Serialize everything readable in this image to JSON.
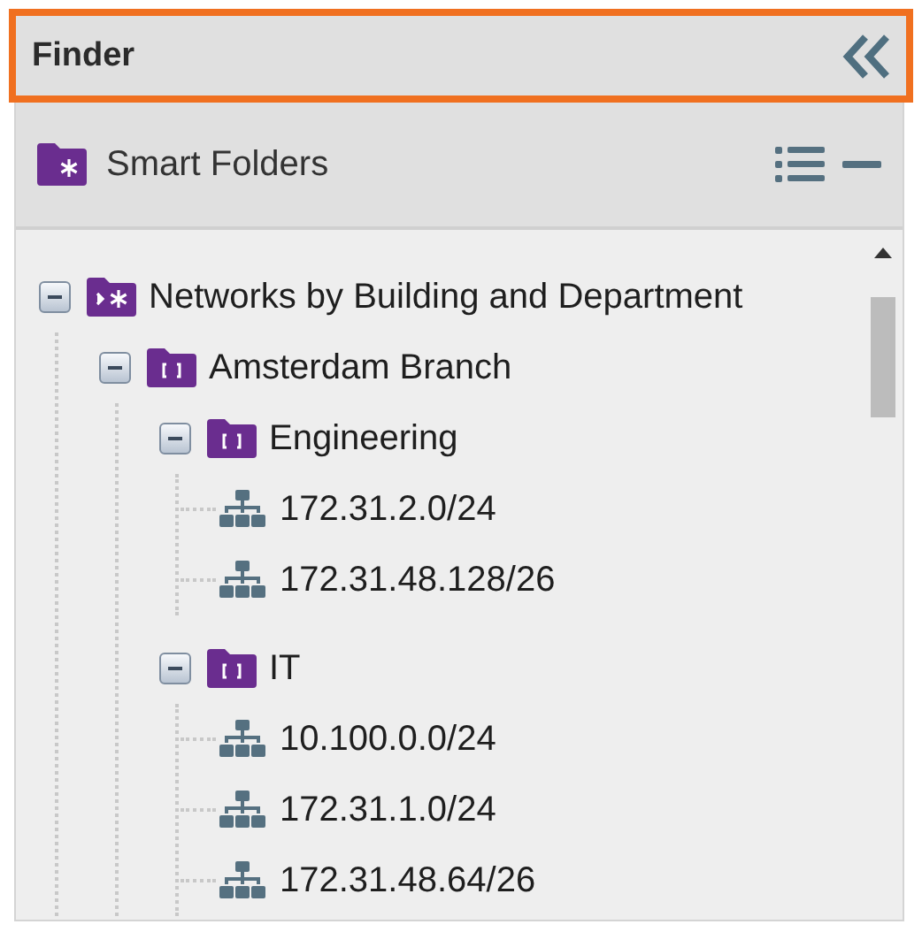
{
  "panel": {
    "title": "Finder"
  },
  "section": {
    "title": "Smart Folders"
  },
  "tree": [
    {
      "kind": "smart-folder",
      "label": "Networks by Building and Department",
      "expanded": true,
      "children": [
        {
          "kind": "folder",
          "label": "Amsterdam Branch",
          "expanded": true,
          "children": [
            {
              "kind": "folder",
              "label": "Engineering",
              "expanded": true,
              "children": [
                {
                  "kind": "network",
                  "label": "172.31.2.0/24"
                },
                {
                  "kind": "network",
                  "label": "172.31.48.128/26"
                }
              ]
            },
            {
              "kind": "folder",
              "label": "IT",
              "expanded": true,
              "children": [
                {
                  "kind": "network",
                  "label": "10.100.0.0/24"
                },
                {
                  "kind": "network",
                  "label": "172.31.1.0/24"
                },
                {
                  "kind": "network",
                  "label": "172.31.48.64/26"
                }
              ]
            }
          ]
        }
      ]
    }
  ]
}
